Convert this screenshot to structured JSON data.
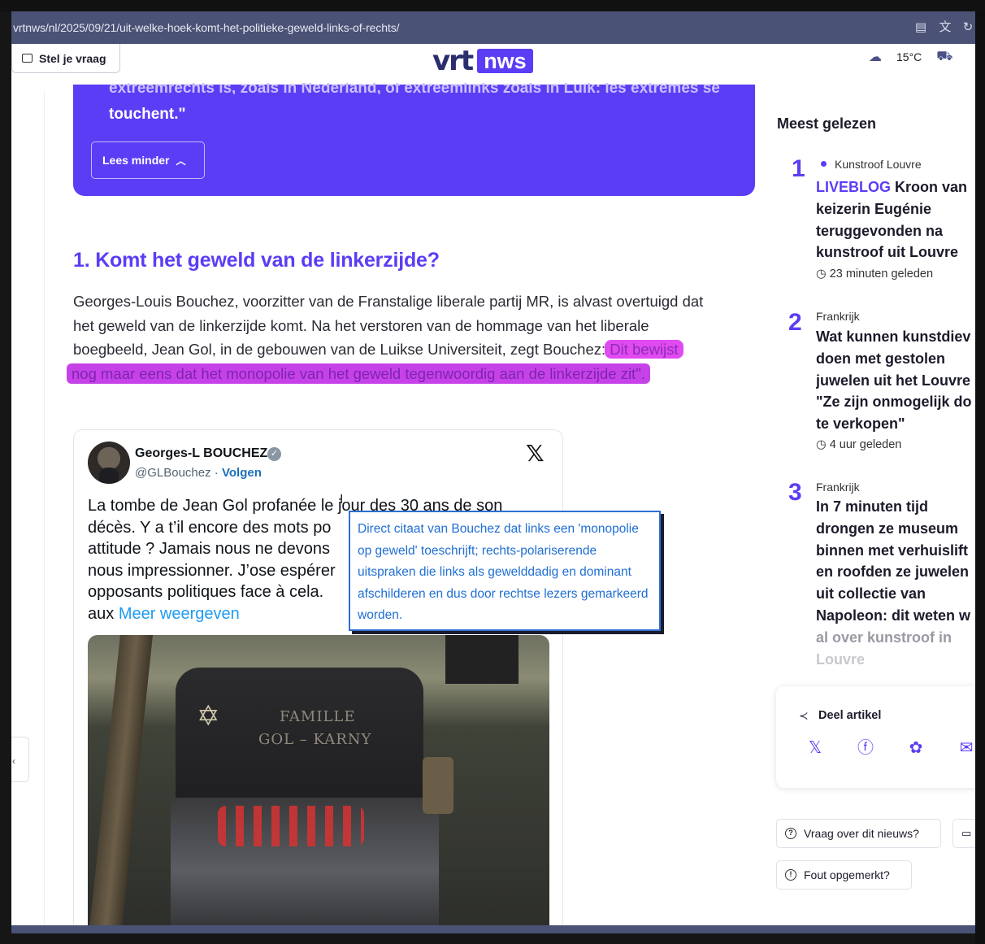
{
  "browser": {
    "url": "vrtnws/nl/2025/09/21/uit-welke-hoek-komt-het-politieke-geweld-links-of-rechts/"
  },
  "header": {
    "ask_label": "Stel je vraag",
    "logo_left": "vrt",
    "logo_right": "nws",
    "temperature": "15°C"
  },
  "quote_card": {
    "cut_line": "extreemrechts is, zoals in Nederland, of extreemlinks zoals in Luik: les extrêmes se",
    "last_line": "touchent.\"",
    "read_less": "Lees minder"
  },
  "article": {
    "heading": "1. Komt het geweld van de linkerzijde?",
    "para_lines": [
      "Georges-Louis Bouchez, voorzitter van de Franstalige liberale partij MR, is alvast overtuigd dat",
      "het geweld van de linkerzijde komt. Na het verstoren van de hommage van het liberale",
      "boegbeeld, Jean Gol, in de gebouwen van de Luikse Universiteit, zegt Bouchez: "
    ],
    "highlight_1": "Dit bewijst",
    "highlight_2": "nog maar eens dat het monopolie van het geweld tegenwoordig aan de linkerzijde zit\"."
  },
  "tweet": {
    "name": "Georges-L BOUCHEZ",
    "handle": "@GLBouchez",
    "separator": " · ",
    "follow": "Volgen",
    "lines": [
      "La tombe de Jean Gol profanée le jour des 30 ans de son",
      "décès. Y a t’il encore des mots po",
      "attitude ? Jamais nous ne devons",
      "nous impressionner. J’ose espérer",
      "opposants politiques face à cela.",
      "aux "
    ],
    "more": "Meer weergeven",
    "photo_text_1": "FAMILLE",
    "photo_text_2": "GOL – KARNY"
  },
  "tooltip": {
    "text": "Direct citaat van Bouchez dat links een 'monopolie op geweld' toeschrijft; rechts-polariserende uitspraken die links als gewelddadig en dominant afschilderen en dus door rechtse lezers gemarkeerd worden."
  },
  "sidebar": {
    "title": "Meest gelezen",
    "items": [
      {
        "num": "1",
        "category": "Kunstroof Louvre",
        "live": "LIVEBLOG",
        "title_lines": [
          "Kroon van",
          "keizerin Eugénie",
          "teruggevonden na",
          "kunstroof uit Louvre"
        ],
        "time": "23 minuten geleden"
      },
      {
        "num": "2",
        "category": "Frankrijk",
        "title_lines": [
          "Wat kunnen kunstdiev",
          "doen met gestolen",
          "juwelen uit het Louvre",
          "\"Ze zijn onmogelijk do",
          "te verkopen\""
        ],
        "time": "4 uur geleden"
      },
      {
        "num": "3",
        "category": "Frankrijk",
        "title_lines": [
          "In 7 minuten tijd",
          "drongen ze museum",
          "binnen met verhuislift",
          "en roofden ze juwelen",
          "uit collectie van",
          "Napoleon: dit weten w",
          "al over kunstroof in",
          "Louvre"
        ]
      }
    ],
    "share": {
      "title": "Deel artikel"
    },
    "question_pill": "Vraag over dit nieuws?",
    "error_pill": "Fout opgemerkt?"
  },
  "colors": {
    "brand_purple": "#5b3df5",
    "highlight_magenta": "#e14af0",
    "tooltip_blue": "#1f6fd3"
  }
}
